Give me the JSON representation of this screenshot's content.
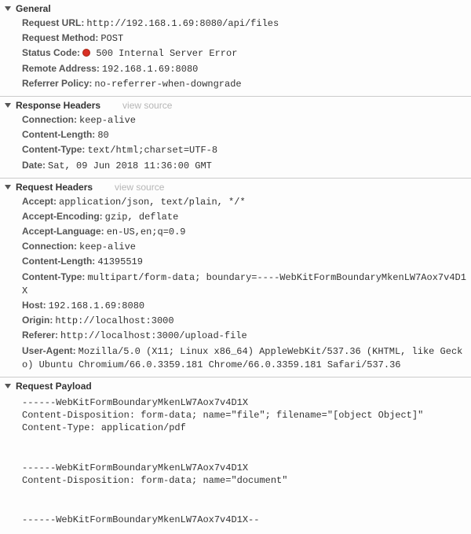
{
  "general": {
    "title": "General",
    "items": [
      {
        "key": "Request URL:",
        "value": "http://192.168.1.69:8080/api/files"
      },
      {
        "key": "Request Method:",
        "value": "POST"
      },
      {
        "key": "Status Code:",
        "value": "500 Internal Server Error",
        "status_dot": true
      },
      {
        "key": "Remote Address:",
        "value": "192.168.1.69:8080"
      },
      {
        "key": "Referrer Policy:",
        "value": "no-referrer-when-downgrade"
      }
    ]
  },
  "response_headers": {
    "title": "Response Headers",
    "view_source": "view source",
    "items": [
      {
        "key": "Connection:",
        "value": "keep-alive"
      },
      {
        "key": "Content-Length:",
        "value": "80"
      },
      {
        "key": "Content-Type:",
        "value": "text/html;charset=UTF-8"
      },
      {
        "key": "Date:",
        "value": "Sat, 09 Jun 2018 11:36:00 GMT"
      }
    ]
  },
  "request_headers": {
    "title": "Request Headers",
    "view_source": "view source",
    "items": [
      {
        "key": "Accept:",
        "value": "application/json, text/plain, */*"
      },
      {
        "key": "Accept-Encoding:",
        "value": "gzip, deflate"
      },
      {
        "key": "Accept-Language:",
        "value": "en-US,en;q=0.9"
      },
      {
        "key": "Connection:",
        "value": "keep-alive"
      },
      {
        "key": "Content-Length:",
        "value": "41395519"
      },
      {
        "key": "Content-Type:",
        "value": "multipart/form-data; boundary=----WebKitFormBoundaryMkenLW7Aox7v4D1X"
      },
      {
        "key": "Host:",
        "value": "192.168.1.69:8080"
      },
      {
        "key": "Origin:",
        "value": "http://localhost:3000"
      },
      {
        "key": "Referer:",
        "value": "http://localhost:3000/upload-file"
      },
      {
        "key": "User-Agent:",
        "value": "Mozilla/5.0 (X11; Linux x86_64) AppleWebKit/537.36 (KHTML, like Gecko) Ubuntu Chromium/66.0.3359.181 Chrome/66.0.3359.181 Safari/537.36"
      }
    ]
  },
  "request_payload": {
    "title": "Request Payload",
    "parts": [
      "------WebKitFormBoundaryMkenLW7Aox7v4D1X\nContent-Disposition: form-data; name=\"file\"; filename=\"[object Object]\"\nContent-Type: application/pdf",
      "------WebKitFormBoundaryMkenLW7Aox7v4D1X\nContent-Disposition: form-data; name=\"document\"",
      "------WebKitFormBoundaryMkenLW7Aox7v4D1X--"
    ]
  }
}
